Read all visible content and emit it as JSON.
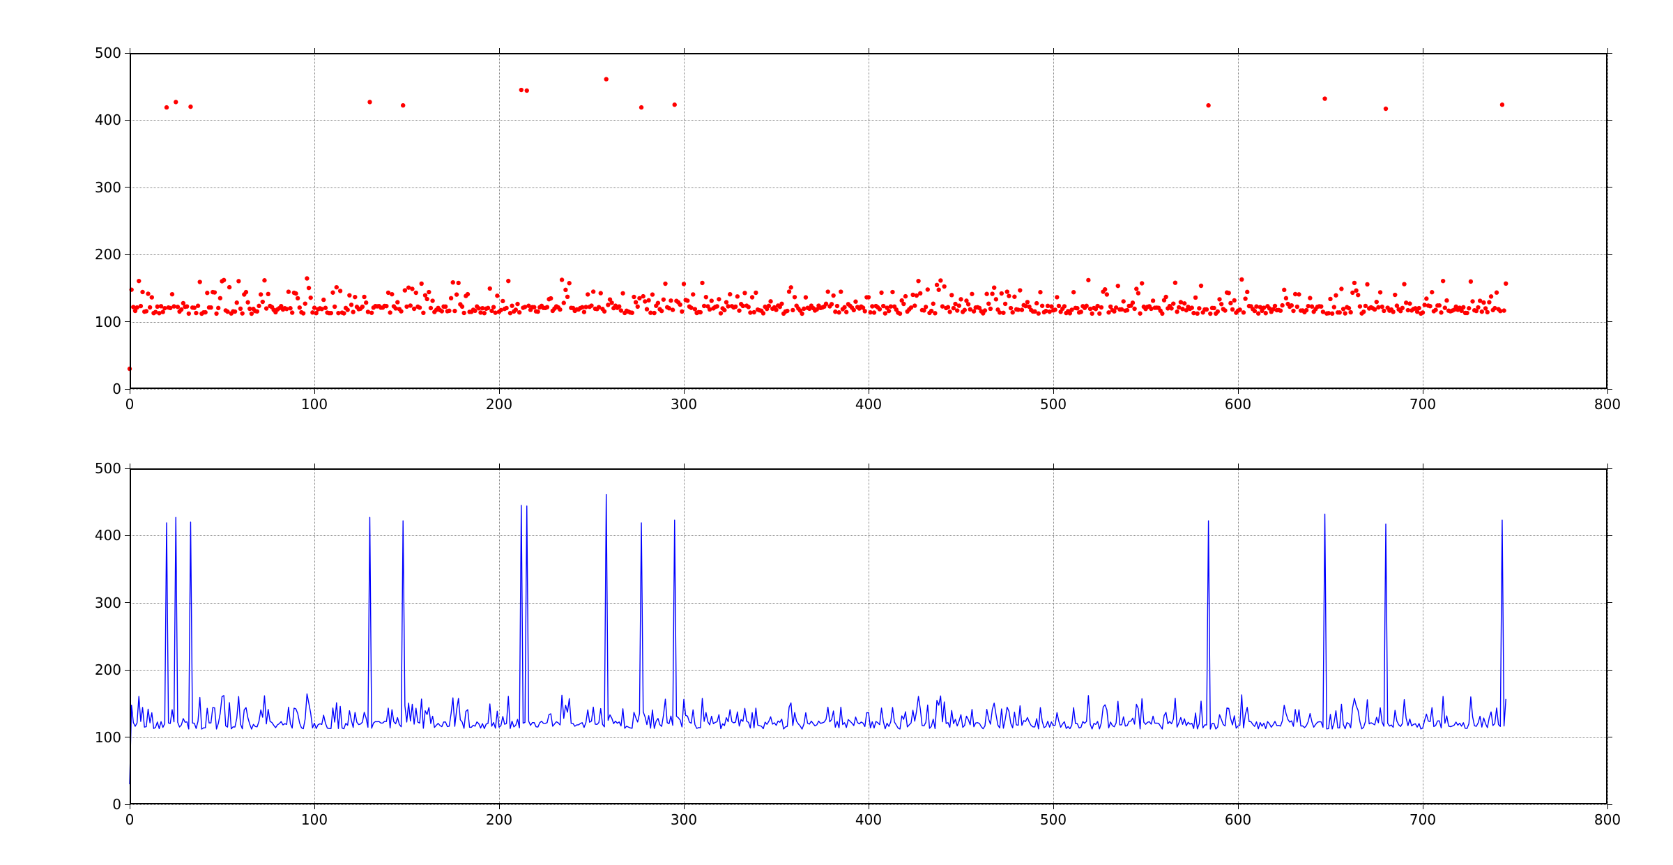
{
  "chart_data": [
    {
      "type": "scatter",
      "title": "",
      "xlabel": "",
      "ylabel": "",
      "xlim": [
        0,
        800
      ],
      "ylim": [
        0,
        500
      ],
      "xticks": [
        0,
        100,
        200,
        300,
        400,
        500,
        600,
        700,
        800
      ],
      "yticks": [
        0,
        100,
        200,
        300,
        400,
        500
      ],
      "color": "#ff0000",
      "marker_size": 3.2,
      "spikes_x": [
        20,
        25,
        33,
        130,
        148,
        212,
        215,
        258,
        277,
        295,
        584,
        647,
        680,
        743
      ],
      "spikes_y": [
        419,
        427,
        420,
        427,
        422,
        445,
        444,
        461,
        419,
        423,
        422,
        432,
        417,
        423
      ],
      "baseline_first_y": 30,
      "noise_band_low": 108,
      "noise_band_high": 165,
      "n_baseline_points": 745
    },
    {
      "type": "line",
      "title": "",
      "xlabel": "",
      "ylabel": "",
      "xlim": [
        0,
        800
      ],
      "ylim": [
        0,
        500
      ],
      "xticks": [
        0,
        100,
        200,
        300,
        400,
        500,
        600,
        700,
        800
      ],
      "yticks": [
        0,
        100,
        200,
        300,
        400,
        500
      ],
      "color": "#0000ff",
      "linewidth": 1.4,
      "spikes_x": [
        20,
        25,
        33,
        130,
        148,
        212,
        215,
        258,
        277,
        295,
        584,
        647,
        680,
        743
      ],
      "spikes_y": [
        419,
        427,
        420,
        427,
        422,
        445,
        444,
        461,
        419,
        423,
        422,
        432,
        417,
        423
      ],
      "baseline_first_y": 30,
      "noise_band_low": 108,
      "noise_band_high": 165,
      "n_baseline_points": 745
    }
  ],
  "colors": {
    "scatter": "#ff0000",
    "line": "#0000ff",
    "spine": "#000000",
    "grid": "rgba(0,0,0,0.5)",
    "background": "#ffffff"
  },
  "tick_labels_x": [
    "0",
    "100",
    "200",
    "300",
    "400",
    "500",
    "600",
    "700",
    "800"
  ],
  "tick_labels_y": [
    "0",
    "100",
    "200",
    "300",
    "400",
    "500"
  ]
}
